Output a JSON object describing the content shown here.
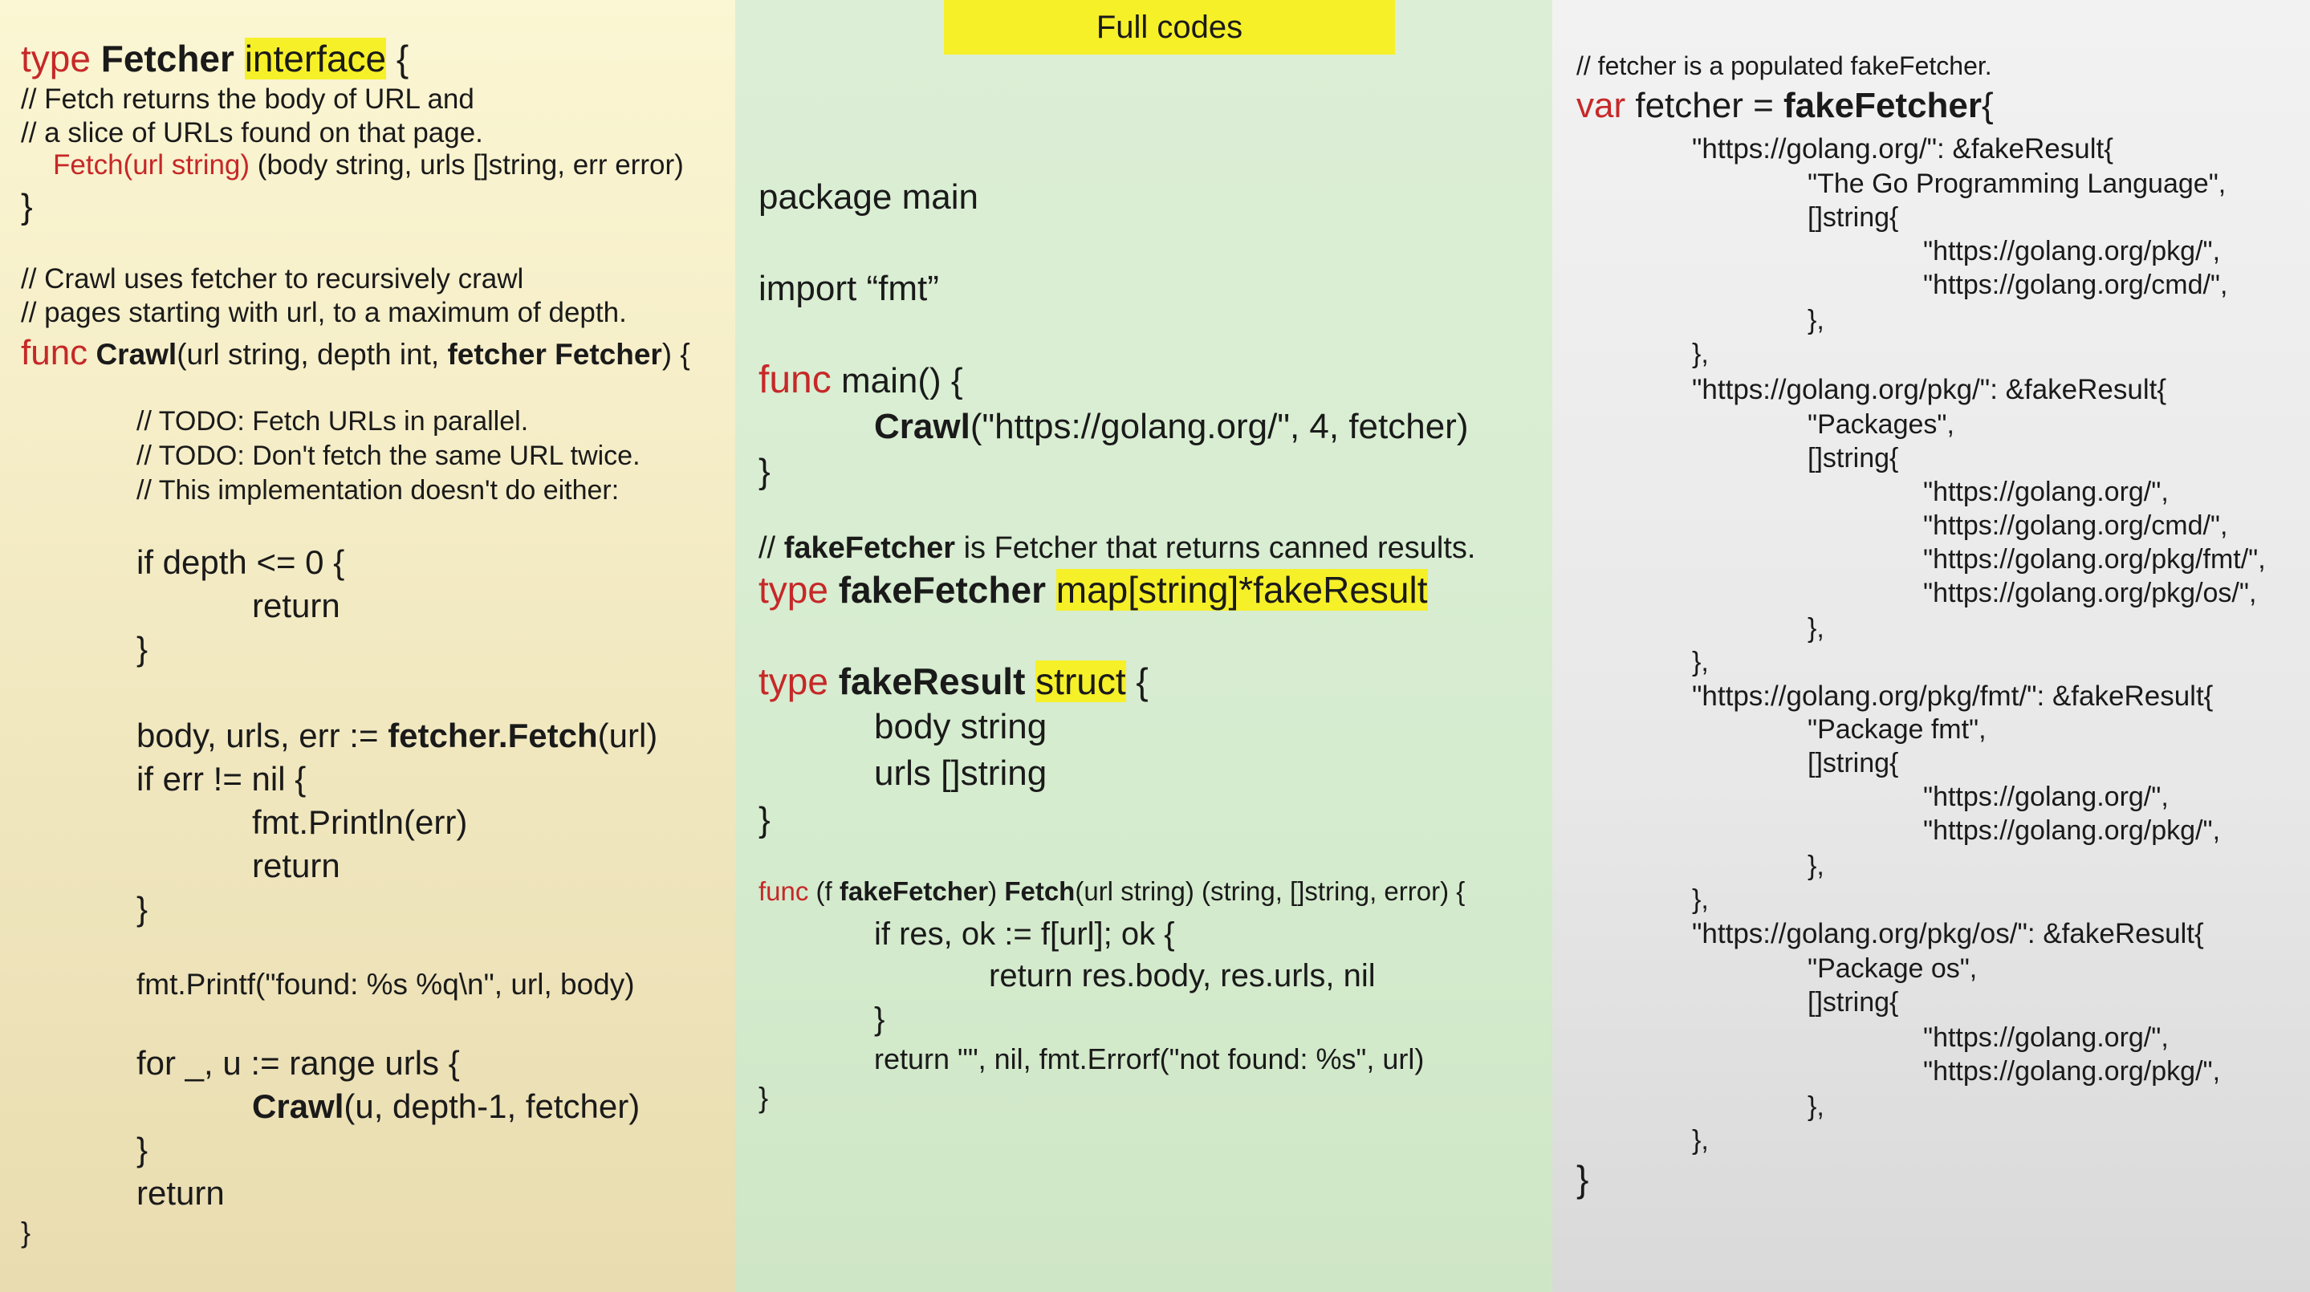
{
  "title": "Full codes",
  "left": {
    "l1": {
      "kw": "type",
      "name": "Fetcher",
      "hl": "interface",
      "tail": " {"
    },
    "l2": "// Fetch returns the body of URL and",
    "l3": "// a slice of URLs found on that page.",
    "l4": {
      "red": "Fetch(url string)",
      "tail": " (body string, urls []string, err error)"
    },
    "l5": "}",
    "l6": "// Crawl uses fetcher to recursively crawl",
    "l7": "// pages starting with url, to a maximum of depth.",
    "l8": {
      "kw": "func",
      "name": "Crawl",
      "mid": "(url string, depth int, ",
      "bold2": "fetcher Fetcher",
      "tail": ") {"
    },
    "l9": "// TODO: Fetch URLs in parallel.",
    "l10": "// TODO: Don't fetch the same URL twice.",
    "l11": "// This implementation doesn't do either:",
    "l12": "if depth <= 0 {",
    "l13": "return",
    "l14": "}",
    "l15": {
      "pre": "body, urls, err := ",
      "bold": "fetcher.Fetch",
      "tail": "(url)"
    },
    "l16": "if err != nil {",
    "l17": "fmt.Println(err)",
    "l18": "return",
    "l19": "}",
    "l20": "fmt.Printf(\"found: %s %q\\n\", url, body)",
    "l21": "for _, u := range urls {",
    "l22": {
      "bold": "Crawl",
      "tail": "(u, depth-1, fetcher)"
    },
    "l23": "}",
    "l24": "return",
    "l25": "}"
  },
  "middle": {
    "m1": "package main",
    "m2": "import “fmt”",
    "m3": {
      "kw": "func",
      "tail": " main() {"
    },
    "m4": {
      "bold": "Crawl",
      "tail": "(\"https://golang.org/\", 4, fetcher)"
    },
    "m5": "}",
    "m6": {
      "pre": "// ",
      "bold": "fakeFetcher",
      "tail": " is Fetcher that returns canned results."
    },
    "m7": {
      "kw": "type",
      "name": "fakeFetcher",
      "hl": "map[string]*fakeResult"
    },
    "m8": {
      "kw": "type",
      "name": "fakeResult",
      "hl": "struct",
      "tail": " {"
    },
    "m9": "body string",
    "m10": "urls []string",
    "m11": "}",
    "m12": {
      "kw": "func",
      "pre": " (f ",
      "bold": "fakeFetcher",
      "mid": ") ",
      "bold2": "Fetch",
      "tail": "(url string) (string, []string, error) {"
    },
    "m13": "if res, ok := f[url]; ok {",
    "m14": "return res.body, res.urls, nil",
    "m15": "}",
    "m16": "return \"\", nil, fmt.Errorf(\"not found: %s\", url)",
    "m17": "}"
  },
  "right": {
    "r1": "// fetcher is a populated fakeFetcher.",
    "r2": {
      "kw": "var",
      "pre": " fetcher = ",
      "bold": "fakeFetcher",
      "tail": "{"
    },
    "r3": "\"https://golang.org/\": &fakeResult{",
    "r4": "\"The Go Programming Language\",",
    "r5": "[]string{",
    "r6": "\"https://golang.org/pkg/\",",
    "r7": "\"https://golang.org/cmd/\",",
    "r8": "},",
    "r9": "},",
    "r10": "\"https://golang.org/pkg/\": &fakeResult{",
    "r11": "\"Packages\",",
    "r12": "[]string{",
    "r13": "\"https://golang.org/\",",
    "r14": "\"https://golang.org/cmd/\",",
    "r15": "\"https://golang.org/pkg/fmt/\",",
    "r16": "\"https://golang.org/pkg/os/\",",
    "r17": "},",
    "r18": "},",
    "r19": "\"https://golang.org/pkg/fmt/\": &fakeResult{",
    "r20": "\"Package fmt\",",
    "r21": "[]string{",
    "r22": "\"https://golang.org/\",",
    "r23": "\"https://golang.org/pkg/\",",
    "r24": "},",
    "r25": "},",
    "r26": "\"https://golang.org/pkg/os/\": &fakeResult{",
    "r27": "\"Package os\",",
    "r28": "[]string{",
    "r29": "\"https://golang.org/\",",
    "r30": "\"https://golang.org/pkg/\",",
    "r31": "},",
    "r32": "},",
    "r33": "}"
  }
}
